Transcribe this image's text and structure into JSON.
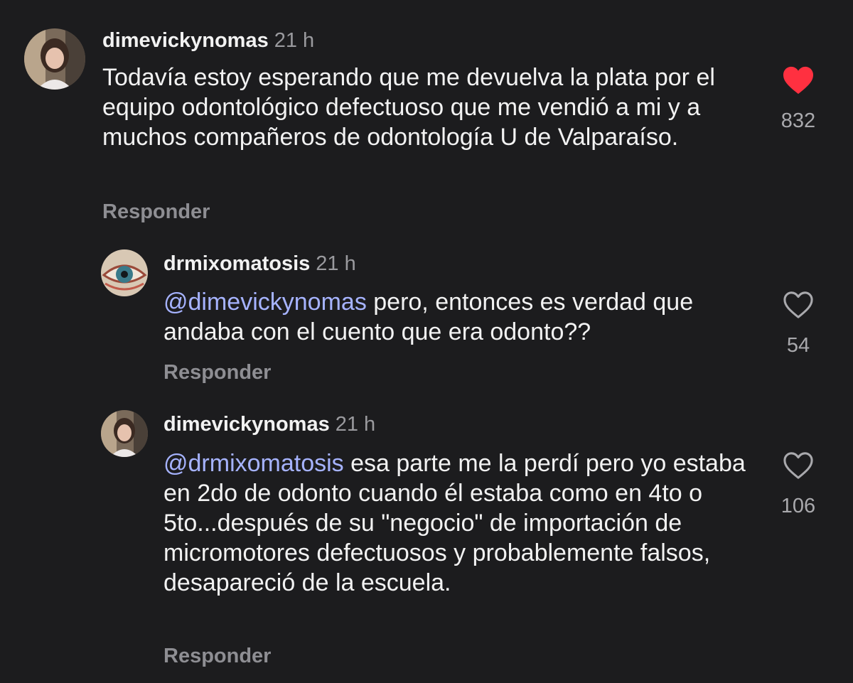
{
  "colors": {
    "background": "#1c1c1e",
    "mention": "#a6b3ff",
    "liked_heart": "#ff3040",
    "muted": "#8e8e93"
  },
  "comments": [
    {
      "username": "dimevickynomas",
      "time": "21 h",
      "mention": "",
      "text": "Todavía estoy esperando que me devuelva la plata por el equipo odontológico defectuoso que me vendió a mi y a muchos compañeros de odontología U de Valparaíso.",
      "likes": "832",
      "liked": true,
      "like_icon": "heart-filled-icon",
      "reply_label": "Responder"
    },
    {
      "username": "drmixomatosis",
      "time": "21 h",
      "mention": "@dimevickynomas",
      "text": " pero, entonces es verdad que andaba con el cuento que era odonto??",
      "likes": "54",
      "liked": false,
      "like_icon": "heart-outline-icon",
      "reply_label": "Responder"
    },
    {
      "username": "dimevickynomas",
      "time": "21 h",
      "mention": "@drmixomatosis",
      "text": " esa parte me la perdí pero yo estaba en 2do de odonto cuando él estaba como en 4to o 5to...después de su \"negocio\" de importación de micromotores defectuosos y probablemente falsos, desapareció de la escuela.",
      "likes": "106",
      "liked": false,
      "like_icon": "heart-outline-icon",
      "reply_label": "Responder"
    }
  ]
}
